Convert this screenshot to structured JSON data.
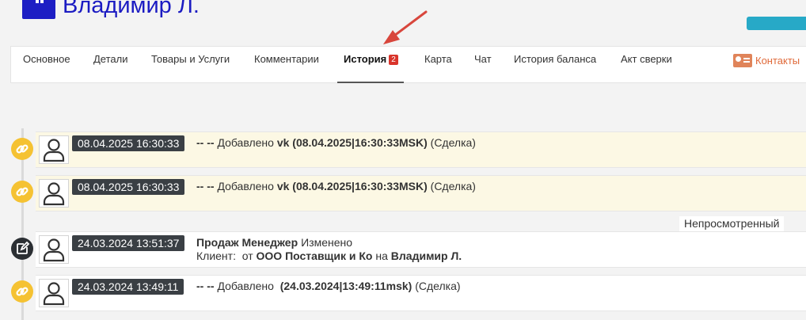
{
  "header": {
    "title": "Владимир Л.",
    "title_color": "#1b1bc2"
  },
  "tabs": [
    {
      "label": "Основное"
    },
    {
      "label": "Детали"
    },
    {
      "label": "Товары и Услуги"
    },
    {
      "label": "Комментарии"
    },
    {
      "label": "История",
      "badge": "2",
      "active": true
    },
    {
      "label": "Карта"
    },
    {
      "label": "Чат"
    },
    {
      "label": "История баланса"
    },
    {
      "label": "Акт сверки"
    }
  ],
  "contacts_label": "Контакты",
  "unread_label": "Непросмотренный",
  "entries": [
    {
      "date": "08.04.2025 16:30:33",
      "marker": "link-icon",
      "prefix": "-- --",
      "action": "Добавлено",
      "bold_value": "vk (08.04.2025|16:30:33MSK)",
      "suffix": "(Сделка)"
    },
    {
      "date": "08.04.2025 16:30:33",
      "marker": "link-icon",
      "prefix": "-- --",
      "action": "Добавлено",
      "bold_value": "vk (08.04.2025|16:30:33MSK)",
      "suffix": "(Сделка)"
    },
    {
      "date": "24.03.2024 13:51:37",
      "marker": "edit-icon",
      "author": "Продаж Менеджер",
      "action": "Изменено",
      "line2_field": "Клиент:",
      "line2_from_word": "от",
      "line2_from": "ООО Поставщик и Ко",
      "line2_to_word": "на",
      "line2_to": "Владимир Л."
    },
    {
      "date": "24.03.2024 13:49:11",
      "marker": "link-icon",
      "prefix": "-- --",
      "action": "Добавлено",
      "bold_value": "(24.03.2024|13:49:11msk)",
      "suffix": "(Сделка)"
    }
  ],
  "colors": {
    "accent_blue": "#1b1bc2",
    "highlight_row": "#fcf8e4",
    "link_marker": "#f5c232",
    "badge_red": "#d9342b",
    "contacts_orange": "#e06a3a"
  }
}
